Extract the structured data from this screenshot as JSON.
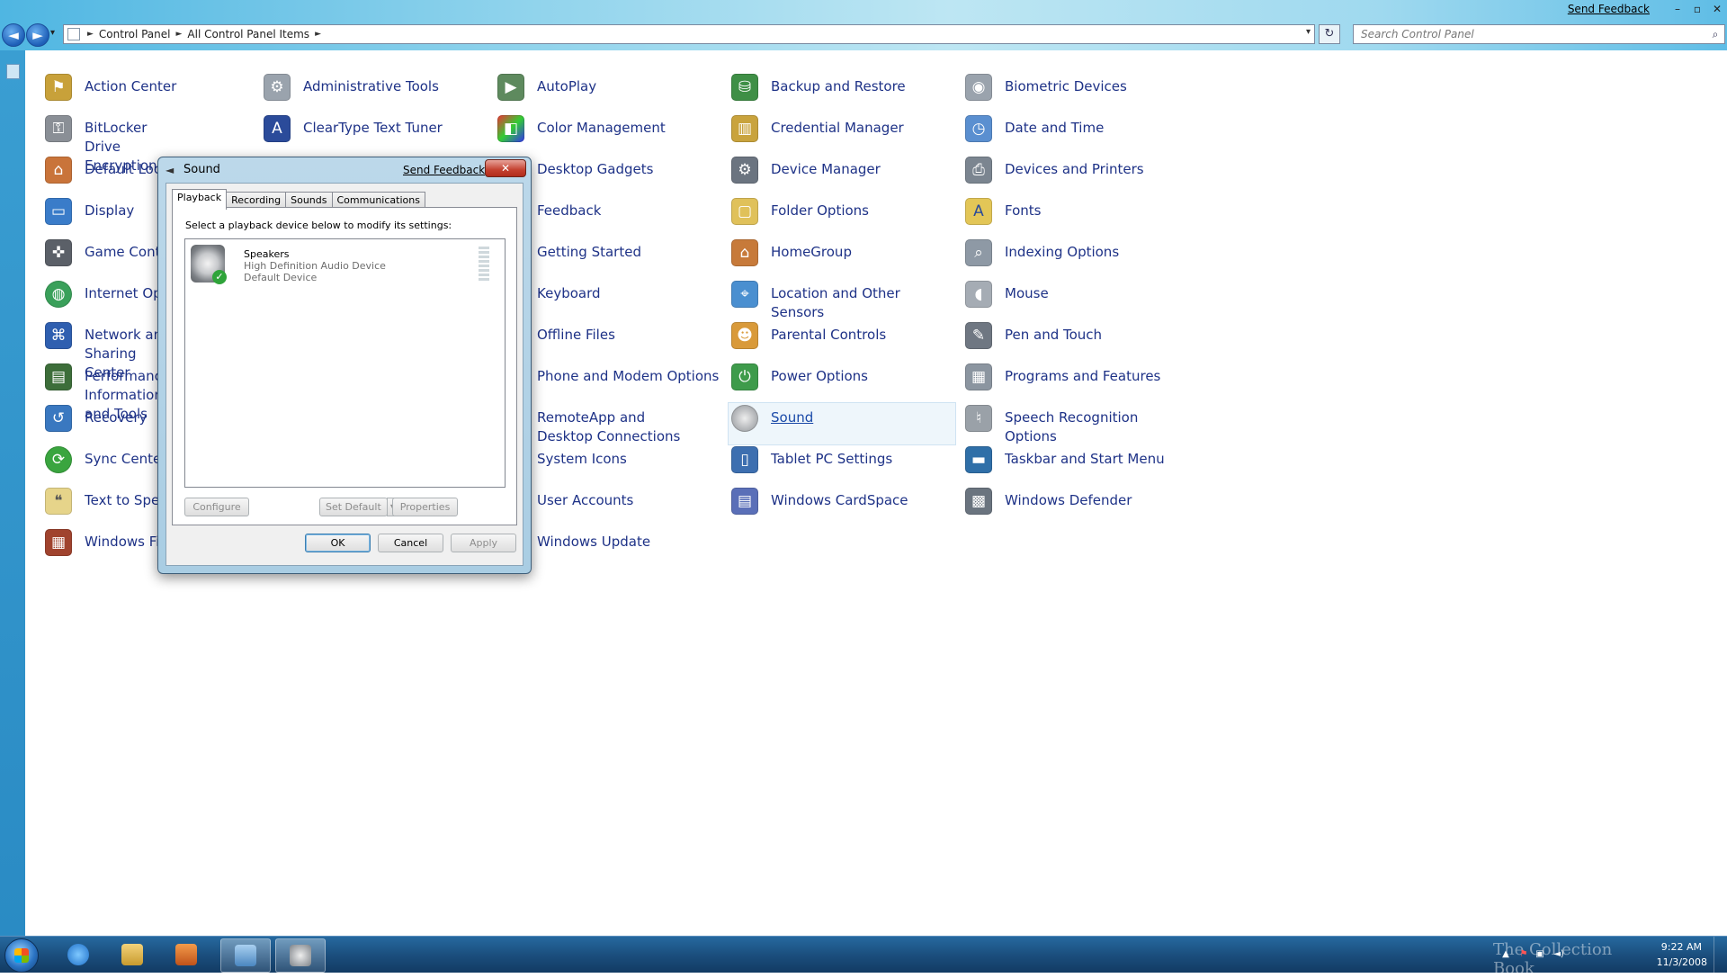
{
  "window": {
    "send_feedback": "Send Feedback",
    "minimize": "–",
    "restore": "▫",
    "close": "✕"
  },
  "address_bar": {
    "back": "◄",
    "forward": "►",
    "history_dropdown": "▾",
    "crumbs": [
      "Control Panel",
      "All Control Panel Items"
    ],
    "separator": "►",
    "dropdown": "▾",
    "refresh": "↻",
    "search_placeholder": "Search Control Panel",
    "search_icon": "⌕"
  },
  "items": {
    "action_center": "Action Center",
    "bitlocker": "BitLocker Drive Encryption",
    "default_locations": "Default Locations",
    "display": "Display",
    "game_controllers": "Game Controllers",
    "internet_options": "Internet Options",
    "network_sharing": "Network and Sharing Center",
    "performance": "Performance Information and Tools",
    "recovery": "Recovery",
    "sync_center": "Sync Center",
    "text_to_speech": "Text to Speech",
    "windows_firewall": "Windows Firewall",
    "administrative_tools": "Administrative Tools",
    "cleartype": "ClearType Text Tuner",
    "autoplay": "AutoPlay",
    "color_management": "Color Management",
    "desktop_gadgets": "Desktop Gadgets",
    "feedback": "Feedback",
    "getting_started": "Getting Started",
    "keyboard": "Keyboard",
    "offline_files": "Offline Files",
    "phone_modem": "Phone and Modem Options",
    "remoteapp": "RemoteApp and Desktop Connections",
    "system_icons": "System Icons",
    "user_accounts": "User Accounts",
    "windows_update": "Windows Update",
    "backup_restore": "Backup and Restore",
    "credential_manager": "Credential Manager",
    "device_manager": "Device Manager",
    "folder_options": "Folder Options",
    "homegroup": "HomeGroup",
    "location_sensors": "Location and Other Sensors",
    "parental_controls": "Parental Controls",
    "power_options": "Power Options",
    "sound": "Sound",
    "tablet_pc": "Tablet PC Settings",
    "cardspace": "Windows CardSpace",
    "biometric": "Biometric Devices",
    "date_time": "Date and Time",
    "devices_printers": "Devices and Printers",
    "fonts": "Fonts",
    "indexing": "Indexing Options",
    "mouse": "Mouse",
    "pen_touch": "Pen and Touch",
    "programs_features": "Programs and Features",
    "speech_recognition": "Speech Recognition Options",
    "taskbar_start": "Taskbar and Start Menu",
    "defender": "Windows Defender"
  },
  "dialog": {
    "title": "Sound",
    "send_feedback": "Send Feedback",
    "close": "✕",
    "tabs": [
      "Playback",
      "Recording",
      "Sounds",
      "Communications"
    ],
    "instruction": "Select a playback device below to modify its settings:",
    "device": {
      "name": "Speakers",
      "description": "High Definition Audio Device",
      "status": "Default Device",
      "check": "✓"
    },
    "buttons": {
      "configure": "Configure",
      "set_default": "Set Default",
      "set_default_arrow": "▼",
      "properties": "Properties",
      "ok": "OK",
      "cancel": "Cancel",
      "apply": "Apply"
    }
  },
  "taskbar": {
    "watermark": "The Collection Book",
    "time": "9:22 AM",
    "date": "11/3/2008",
    "tray_up": "▲",
    "tray_flag": "⚑",
    "tray_network": "▣",
    "tray_volume": "◄)"
  },
  "colors": {
    "link_text": "#1e3287",
    "accent": "#2b74c4"
  }
}
